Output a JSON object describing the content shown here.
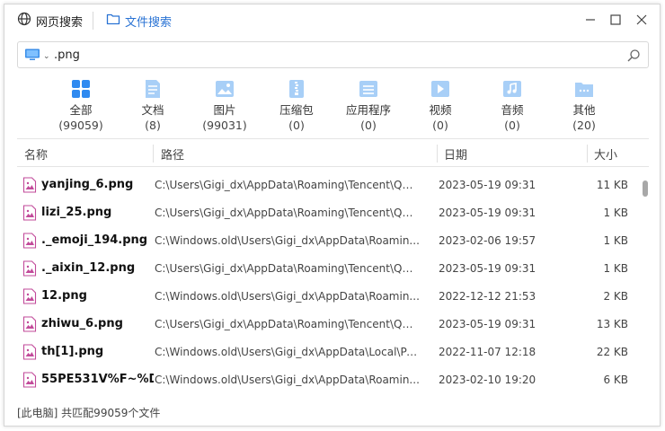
{
  "titlebar": {
    "web_tab": "网页搜索",
    "file_tab": "文件搜索"
  },
  "search": {
    "scope_icon": "computer-icon",
    "query": ".png"
  },
  "categories": [
    {
      "label": "全部",
      "count": "(99059)",
      "icon": "grid-icon"
    },
    {
      "label": "文档",
      "count": "(8)",
      "icon": "document-icon"
    },
    {
      "label": "图片",
      "count": "(99031)",
      "icon": "image-icon"
    },
    {
      "label": "压缩包",
      "count": "(0)",
      "icon": "zip-icon"
    },
    {
      "label": "应用程序",
      "count": "(0)",
      "icon": "app-icon"
    },
    {
      "label": "视频",
      "count": "(0)",
      "icon": "video-icon"
    },
    {
      "label": "音频",
      "count": "(0)",
      "icon": "audio-icon"
    },
    {
      "label": "其他",
      "count": "(20)",
      "icon": "folder-icon"
    }
  ],
  "table": {
    "headers": {
      "name": "名称",
      "path": "路径",
      "date": "日期",
      "size": "大小"
    },
    "rows": [
      {
        "name": "yanjing_6.png",
        "path": "C:\\Users\\Gigi_dx\\AppData\\Roaming\\Tencent\\QQ...",
        "date": "2023-05-19 09:31",
        "size": "11 KB"
      },
      {
        "name": "lizi_25.png",
        "path": "C:\\Users\\Gigi_dx\\AppData\\Roaming\\Tencent\\QQ...",
        "date": "2023-05-19 09:31",
        "size": "1 KB"
      },
      {
        "name": "._emoji_194.png",
        "path": "C:\\Windows.old\\Users\\Gigi_dx\\AppData\\Roamin...",
        "date": "2023-02-06 19:57",
        "size": "1 KB"
      },
      {
        "name": "._aixin_12.png",
        "path": "C:\\Users\\Gigi_dx\\AppData\\Roaming\\Tencent\\QQ...",
        "date": "2023-05-19 09:31",
        "size": "1 KB"
      },
      {
        "name": "12.png",
        "path": "C:\\Windows.old\\Users\\Gigi_dx\\AppData\\Roamin...",
        "date": "2022-12-12 21:53",
        "size": "2 KB"
      },
      {
        "name": "zhiwu_6.png",
        "path": "C:\\Users\\Gigi_dx\\AppData\\Roaming\\Tencent\\QQ...",
        "date": "2023-05-19 09:31",
        "size": "13 KB"
      },
      {
        "name": "th[1].png",
        "path": "C:\\Windows.old\\Users\\Gigi_dx\\AppData\\Local\\Pa...",
        "date": "2022-11-07 12:18",
        "size": "22 KB"
      },
      {
        "name": "55PE531V%F~%D",
        "path": "C:\\Windows.old\\Users\\Gigi_dx\\AppData\\Roamin...",
        "date": "2023-02-10 19:20",
        "size": "6 KB"
      }
    ]
  },
  "status": "[此电脑] 共匹配99059个文件",
  "colors": {
    "accent": "#2a73d4",
    "icon_blue": "#5aa3f0"
  }
}
